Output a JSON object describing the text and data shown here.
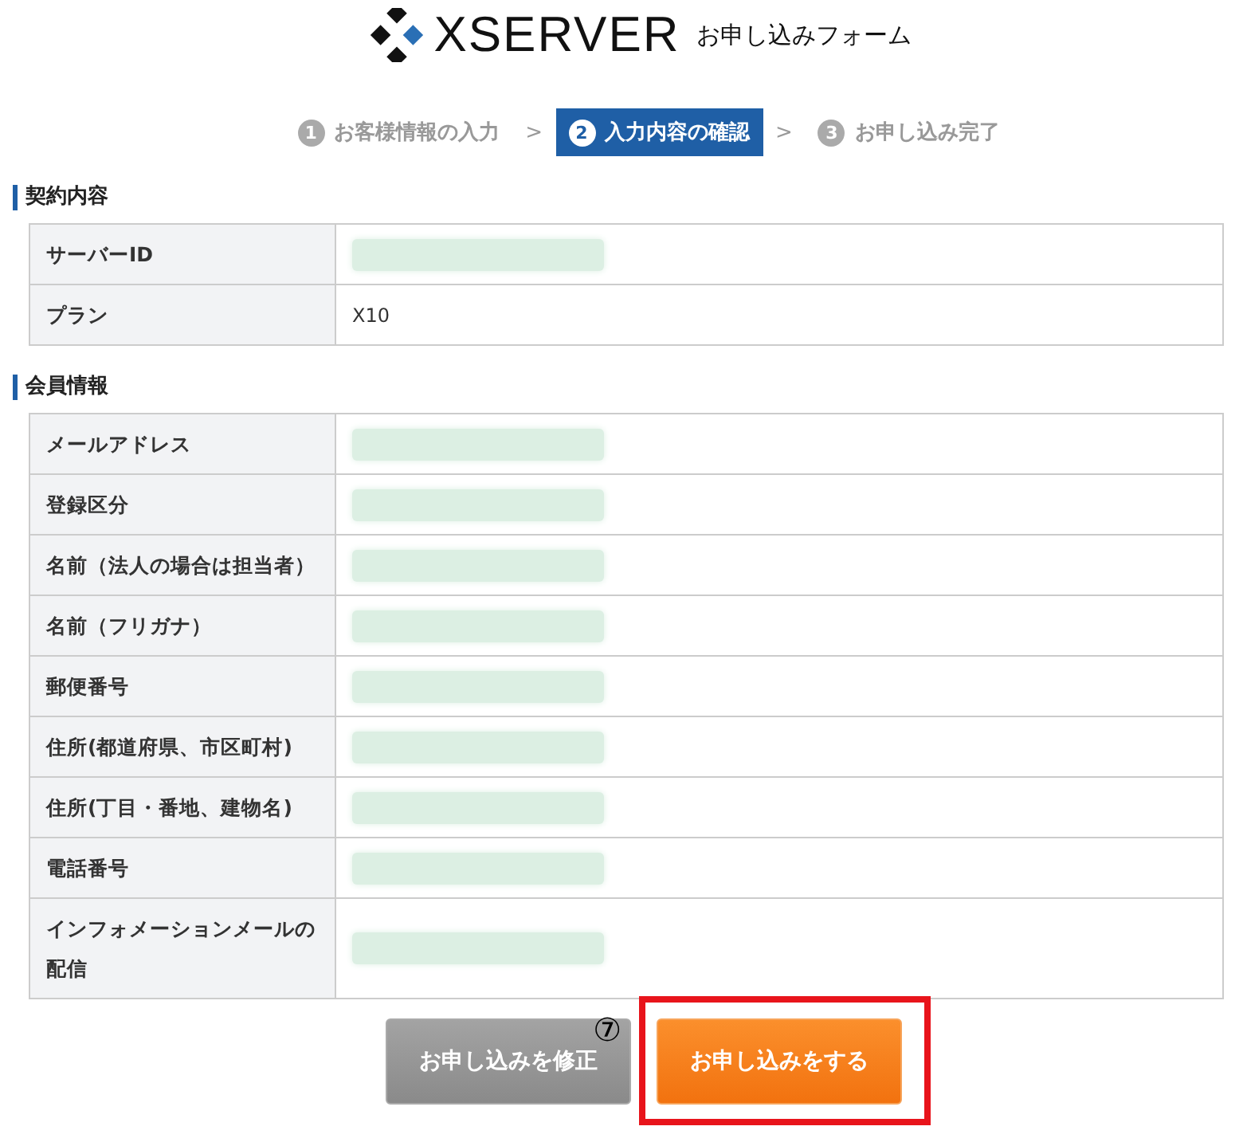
{
  "header": {
    "brand": "XSERVER",
    "subtitle": "お申し込みフォーム"
  },
  "steps": {
    "separator": ">",
    "items": [
      {
        "number": "1",
        "label": "お客様情報の入力",
        "selected": false
      },
      {
        "number": "2",
        "label": "入力内容の確認",
        "selected": true
      },
      {
        "number": "3",
        "label": "お申し込み完了",
        "selected": false
      }
    ]
  },
  "sections": [
    {
      "title": "契約内容",
      "rows": [
        {
          "label": "サーバーID",
          "redacted": true
        },
        {
          "label": "プラン",
          "value": "X10",
          "redacted": false
        }
      ]
    },
    {
      "title": "会員情報",
      "rows": [
        {
          "label": "メールアドレス",
          "redacted": true
        },
        {
          "label": "登録区分",
          "redacted": true
        },
        {
          "label": "名前（法人の場合は担当者）",
          "redacted": true
        },
        {
          "label": "名前（フリガナ）",
          "redacted": true
        },
        {
          "label": "郵便番号",
          "redacted": true
        },
        {
          "label": "住所(都道府県、市区町村)",
          "redacted": true
        },
        {
          "label": "住所(丁目・番地、建物名)",
          "redacted": true
        },
        {
          "label": "電話番号",
          "redacted": true
        },
        {
          "label": "インフォメーションメールの配信",
          "redacted": true
        }
      ]
    }
  ],
  "buttons": [
    {
      "label": "お申し込みを修正",
      "kind": "secondary",
      "highlighted": false
    },
    {
      "label": "お申し込みをする",
      "kind": "primary",
      "highlighted": true
    }
  ],
  "annotation": {
    "marker": "⑦"
  }
}
